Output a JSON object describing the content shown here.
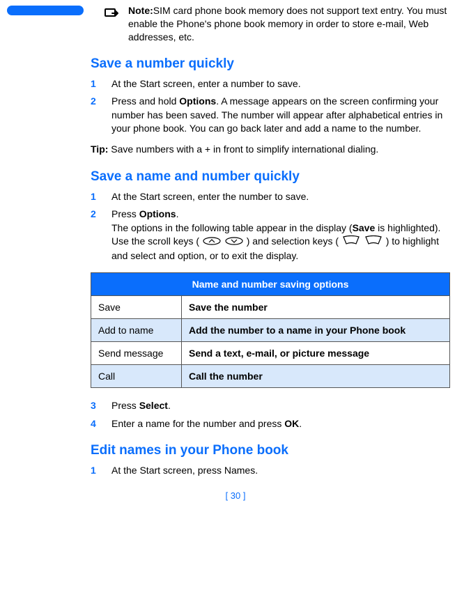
{
  "note": {
    "label": "Note:",
    "text": "SIM card phone book memory does not support text entry. You must enable the Phone's phone book memory in order to store e-mail, Web addresses, etc."
  },
  "section1": {
    "title": "Save a number quickly",
    "step1": "At the Start screen, enter a number to save.",
    "step2_a": "Press and hold ",
    "step2_bold": "Options",
    "step2_b": ". A message appears on the screen confirming your number has been saved. The number will appear after alphabetical entries in your phone book. You can go back later and add a name to the number.",
    "tip_label": "Tip:",
    "tip_text": "  Save numbers with a + in front to simplify international dialing."
  },
  "section2": {
    "title": "Save a name and number quickly",
    "step1": "At the Start screen, enter the number to save.",
    "step2_a": "Press ",
    "step2_bold": "Options",
    "step2_b": ".",
    "step2_line2_a": "The options in the following table appear in the display (",
    "step2_line2_bold": "Save",
    "step2_line2_b": " is highlighted). Use the scroll keys (",
    "step2_line2_c": ") and selection keys (",
    "step2_line2_d": ") to highlight and select and option, or to exit the display.",
    "step3_a": "Press ",
    "step3_bold": "Select",
    "step3_b": ".",
    "step4_a": "Enter a name for the number and press ",
    "step4_bold": "OK",
    "step4_b": "."
  },
  "table": {
    "header": "Name and number saving options",
    "rows": [
      {
        "left": "Save",
        "right": "Save the number"
      },
      {
        "left": "Add to name",
        "right": "Add the number to a name in your Phone book"
      },
      {
        "left": "Send message",
        "right": "Send a text, e-mail, or picture message"
      },
      {
        "left": "Call",
        "right": "Call the number"
      }
    ]
  },
  "section3": {
    "title": "Edit names in your Phone book",
    "step1": "At the Start screen, press Names."
  },
  "nums": {
    "n1": "1",
    "n2": "2",
    "n3": "3",
    "n4": "4"
  },
  "page_number": "[ 30 ]"
}
